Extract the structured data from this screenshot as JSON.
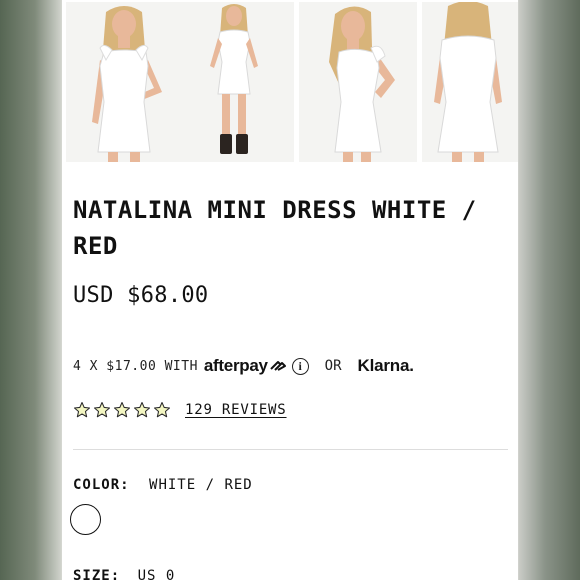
{
  "product": {
    "title": "NATALINA MINI DRESS WHITE / RED",
    "price": "USD $68.00"
  },
  "payment": {
    "installments_text": "4 X $17.00 WITH",
    "afterpay_label": "afterpay",
    "or_text": "OR",
    "klarna_label": "Klarna."
  },
  "rating": {
    "stars_filled": 0,
    "stars_total": 5,
    "reviews_link": "129 REVIEWS"
  },
  "options": {
    "color_label": "COLOR:",
    "color_value": "WHITE / RED",
    "size_label": "SIZE:",
    "size_value": "US 0"
  },
  "images": [
    {
      "icon": "product-photo-front"
    },
    {
      "icon": "product-photo-full-length"
    },
    {
      "icon": "product-photo-side"
    },
    {
      "icon": "product-photo-back"
    }
  ],
  "colors": {
    "star_fill": "#f3f6c2",
    "star_stroke": "#2a2a2a",
    "dress": "#ffffff",
    "hair": "#d8b47a",
    "skin": "#e8b89a"
  }
}
